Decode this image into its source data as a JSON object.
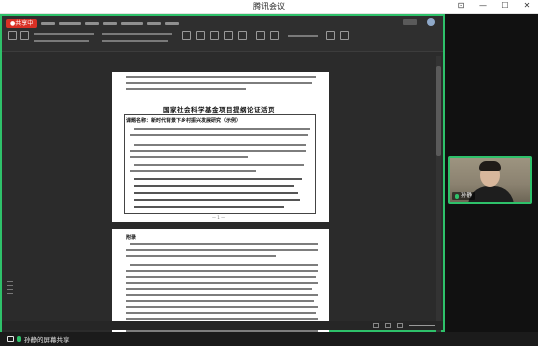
{
  "window": {
    "title": "腾讯会议",
    "controls": {
      "pin": "⊡",
      "minimize": "—",
      "maximize": "☐",
      "close": "✕"
    }
  },
  "share": {
    "badge": "●共享中",
    "border_color": "#2ec16a"
  },
  "document": {
    "title": "国家社会科学基金项目提纲论证活页",
    "subtitle": "课题名称：新时代背景下乡村振兴发展研究（示例）",
    "page_number": "— 1 —",
    "section_label": "附录"
  },
  "participant": {
    "name": "孙静",
    "mic_icon": "mic-icon"
  },
  "bottom_bar": {
    "share_label": "孙静的屏幕共享",
    "icons": [
      "screen-share-icon",
      "mic-icon"
    ]
  }
}
